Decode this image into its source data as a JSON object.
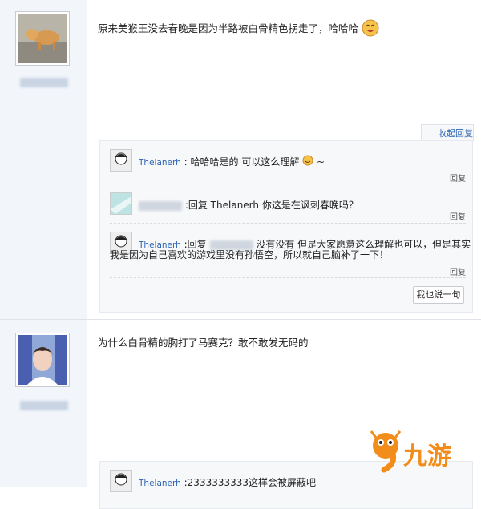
{
  "posts": [
    {
      "content": "原来美猴王没去春晚是因为半路被白骨精色拐走了，哈哈哈",
      "emoji": "laughing-emoji",
      "reply_toggle": "收起回复",
      "replies": [
        {
          "user": "Thelanerh",
          "text": "哈哈哈是的 可以这么理解",
          "tail": "~",
          "action": "回复"
        },
        {
          "user": "",
          "text": ":回复 Thelanerh 你这是在讽刺春晚吗？",
          "action": "回复"
        },
        {
          "user": "Thelanerh",
          "text": ":回复",
          "text2": "没有没有 但是大家愿意这么理解也可以，但是其实",
          "line2": "我是因为自己喜欢的游戏里没有孙悟空，所以就自己脑补了一下！",
          "action": "回复"
        }
      ],
      "say_button": "我也说一句"
    },
    {
      "content": "为什么白骨精的胸打了马赛克？敢不敢发无码的",
      "replies": [
        {
          "user": "Thelanerh",
          "text": ":2333333333这样会被屏蔽吧"
        }
      ]
    }
  ],
  "logo": {
    "text": "九游"
  },
  "colors": {
    "link": "#2d64b3",
    "left_bg": "#f2f6fb",
    "logo_orange": "#f28c1b"
  }
}
